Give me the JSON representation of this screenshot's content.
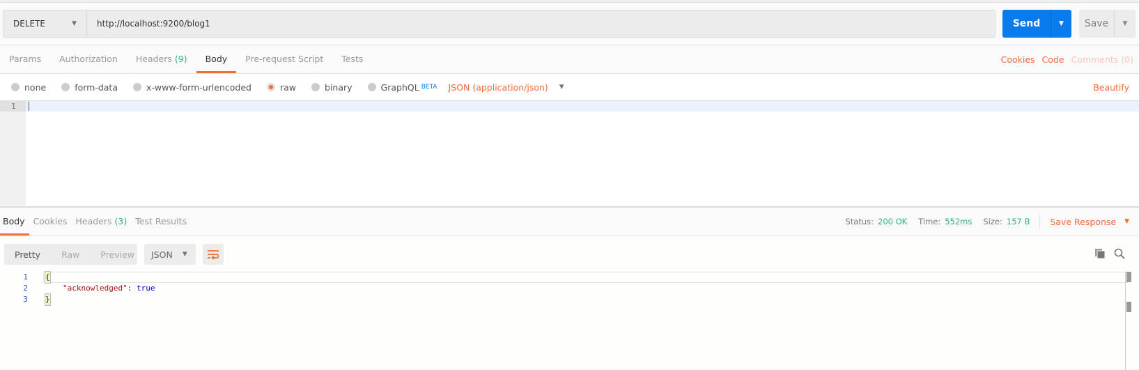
{
  "request": {
    "method": "DELETE",
    "url": "http://localhost:9200/blog1",
    "send_label": "Send",
    "save_label": "Save"
  },
  "tabs": [
    {
      "label": "Params"
    },
    {
      "label": "Authorization"
    },
    {
      "label": "Headers",
      "count": "(9)"
    },
    {
      "label": "Body"
    },
    {
      "label": "Pre-request Script"
    },
    {
      "label": "Tests"
    }
  ],
  "right_links": {
    "cookies": "Cookies",
    "code": "Code",
    "comments": "Comments (0)"
  },
  "body_types": [
    {
      "label": "none"
    },
    {
      "label": "form-data"
    },
    {
      "label": "x-www-form-urlencoded"
    },
    {
      "label": "raw",
      "selected": true
    },
    {
      "label": "binary"
    },
    {
      "label": "GraphQL",
      "badge": "BETA"
    }
  ],
  "content_type": "JSON (application/json)",
  "beautify": "Beautify",
  "editor": {
    "line_numbers": [
      "1"
    ]
  },
  "response": {
    "tabs": [
      {
        "label": "Body"
      },
      {
        "label": "Cookies"
      },
      {
        "label": "Headers",
        "count": "(3)"
      },
      {
        "label": "Test Results"
      }
    ],
    "status_label": "Status:",
    "status": "200 OK",
    "time_label": "Time:",
    "time": "552ms",
    "size_label": "Size:",
    "size": "157 B",
    "save_response": "Save Response",
    "views": [
      "Pretty",
      "Raw",
      "Preview"
    ],
    "format": "JSON",
    "code": {
      "lines": [
        {
          "n": "1",
          "open": "{"
        },
        {
          "n": "2",
          "key": "\"acknowledged\"",
          "colon": ": ",
          "value": "true"
        },
        {
          "n": "3",
          "close": "}"
        }
      ]
    }
  },
  "colors": {
    "accent": "#f26b3a",
    "send": "#097bed",
    "success": "#2fb47c"
  }
}
